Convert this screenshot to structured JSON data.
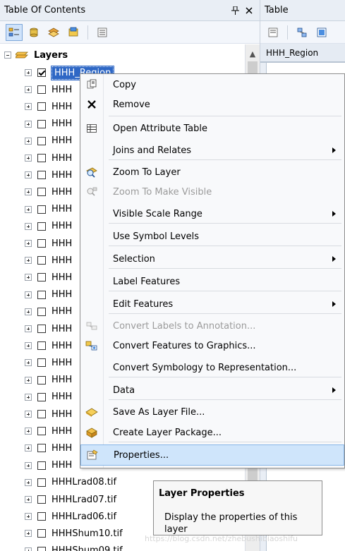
{
  "toc": {
    "title": "Table Of Contents",
    "pin_glyph": "ꟸ",
    "close_glyph": "✕",
    "root_label": "Layers",
    "layers": [
      {
        "label": "HHH_Region",
        "checked": true,
        "selected": true
      },
      {
        "label": "HHH",
        "checked": false
      },
      {
        "label": "HHH",
        "checked": false
      },
      {
        "label": "HHH",
        "checked": false
      },
      {
        "label": "HHH",
        "checked": false
      },
      {
        "label": "HHH",
        "checked": false
      },
      {
        "label": "HHH",
        "checked": false
      },
      {
        "label": "HHH",
        "checked": false
      },
      {
        "label": "HHH",
        "checked": false
      },
      {
        "label": "HHH",
        "checked": false
      },
      {
        "label": "HHH",
        "checked": false
      },
      {
        "label": "HHH",
        "checked": false
      },
      {
        "label": "HHH",
        "checked": false
      },
      {
        "label": "HHH",
        "checked": false
      },
      {
        "label": "HHH",
        "checked": false
      },
      {
        "label": "HHH",
        "checked": false
      },
      {
        "label": "HHH",
        "checked": false
      },
      {
        "label": "HHH",
        "checked": false
      },
      {
        "label": "HHH",
        "checked": false
      },
      {
        "label": "HHH",
        "checked": false
      },
      {
        "label": "HHH",
        "checked": false
      },
      {
        "label": "HHH",
        "checked": false
      },
      {
        "label": "HHH",
        "checked": false
      },
      {
        "label": "HHH",
        "checked": false
      },
      {
        "label": "HHHLrad08.tif",
        "checked": false
      },
      {
        "label": "HHHLrad07.tif",
        "checked": false
      },
      {
        "label": "HHHLrad06.tif",
        "checked": false
      },
      {
        "label": "HHHShum10.tif",
        "checked": false
      },
      {
        "label": "HHHShum09.tif",
        "checked": false
      }
    ]
  },
  "table": {
    "title": "Table",
    "column_header": "HHH_Region"
  },
  "menu": {
    "items": [
      {
        "label": "Copy",
        "icon": "copy-icon",
        "disabled": false,
        "submenu": false
      },
      {
        "label": "Remove",
        "icon": "remove-icon",
        "disabled": false,
        "submenu": false
      },
      {
        "label": "Open Attribute Table",
        "icon": "attribute-table-icon",
        "disabled": false,
        "submenu": false
      },
      {
        "label": "Joins and Relates",
        "icon": "",
        "disabled": false,
        "submenu": true
      },
      {
        "label": "Zoom To Layer",
        "icon": "zoom-to-layer-icon",
        "disabled": false,
        "submenu": false
      },
      {
        "label": "Zoom To Make Visible",
        "icon": "zoom-visible-icon",
        "disabled": true,
        "submenu": false
      },
      {
        "label": "Visible Scale Range",
        "icon": "",
        "disabled": false,
        "submenu": true
      },
      {
        "label": "Use Symbol Levels",
        "icon": "",
        "disabled": false,
        "submenu": false
      },
      {
        "label": "Selection",
        "icon": "",
        "disabled": false,
        "submenu": true
      },
      {
        "label": "Label Features",
        "icon": "",
        "disabled": false,
        "submenu": false
      },
      {
        "label": "Edit Features",
        "icon": "",
        "disabled": false,
        "submenu": true
      },
      {
        "label": "Convert Labels to Annotation...",
        "icon": "convert-labels-icon",
        "disabled": true,
        "submenu": false
      },
      {
        "label": "Convert Features to Graphics...",
        "icon": "convert-features-icon",
        "disabled": false,
        "submenu": false
      },
      {
        "label": "Convert Symbology to Representation...",
        "icon": "",
        "disabled": false,
        "submenu": false
      },
      {
        "label": "Data",
        "icon": "",
        "disabled": false,
        "submenu": true
      },
      {
        "label": "Save As Layer File...",
        "icon": "save-layer-icon",
        "disabled": false,
        "submenu": false
      },
      {
        "label": "Create Layer Package...",
        "icon": "layer-package-icon",
        "disabled": false,
        "submenu": false
      },
      {
        "label": "Properties...",
        "icon": "properties-icon",
        "disabled": false,
        "submenu": false,
        "highlight": true
      }
    ]
  },
  "tooltip": {
    "title": "Layer Properties",
    "body": "Display the properties of this layer"
  },
  "watermark": "https://blog.csdn.net/zhebushibiaoshifu"
}
